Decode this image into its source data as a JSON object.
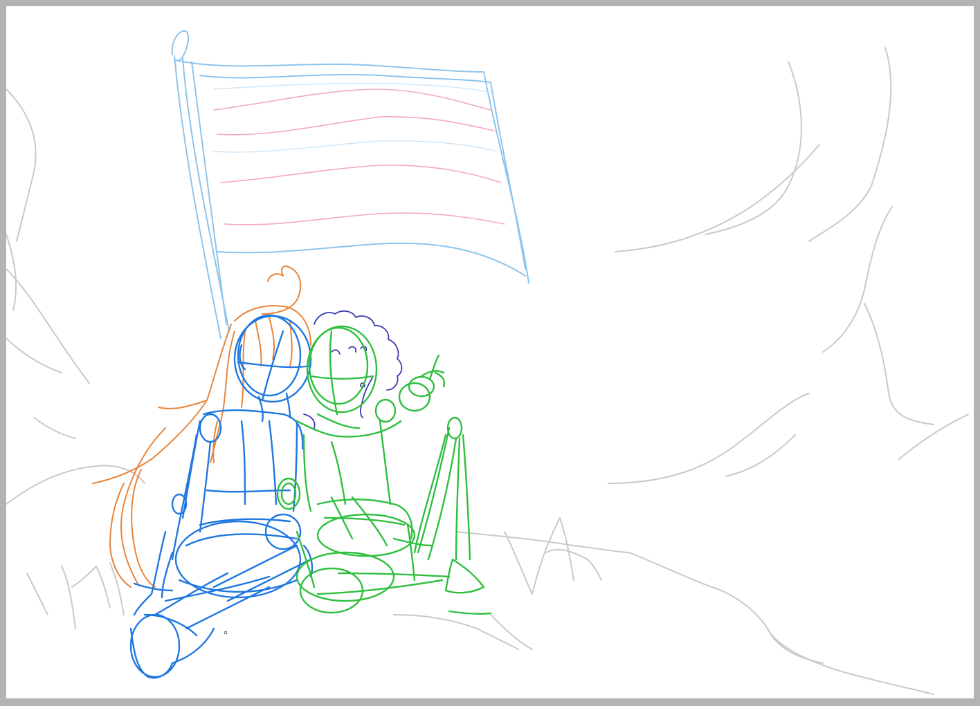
{
  "canvas": {
    "background": "#ffffff",
    "frame": "#b3b3b3"
  },
  "layers": {
    "background_sketch": {
      "color": "#c8c8c8"
    },
    "flag": {
      "pole_color": "#8cc4ee",
      "outline_color": "#8cc4ee",
      "stripe_color": "#f2a9c0"
    },
    "hair_orange": {
      "color": "#e8843a"
    },
    "figure_blue": {
      "color": "#1f78e0"
    },
    "hair_purple": {
      "color": "#3a3ab0"
    },
    "figure_green": {
      "color": "#2fbf3f"
    }
  }
}
